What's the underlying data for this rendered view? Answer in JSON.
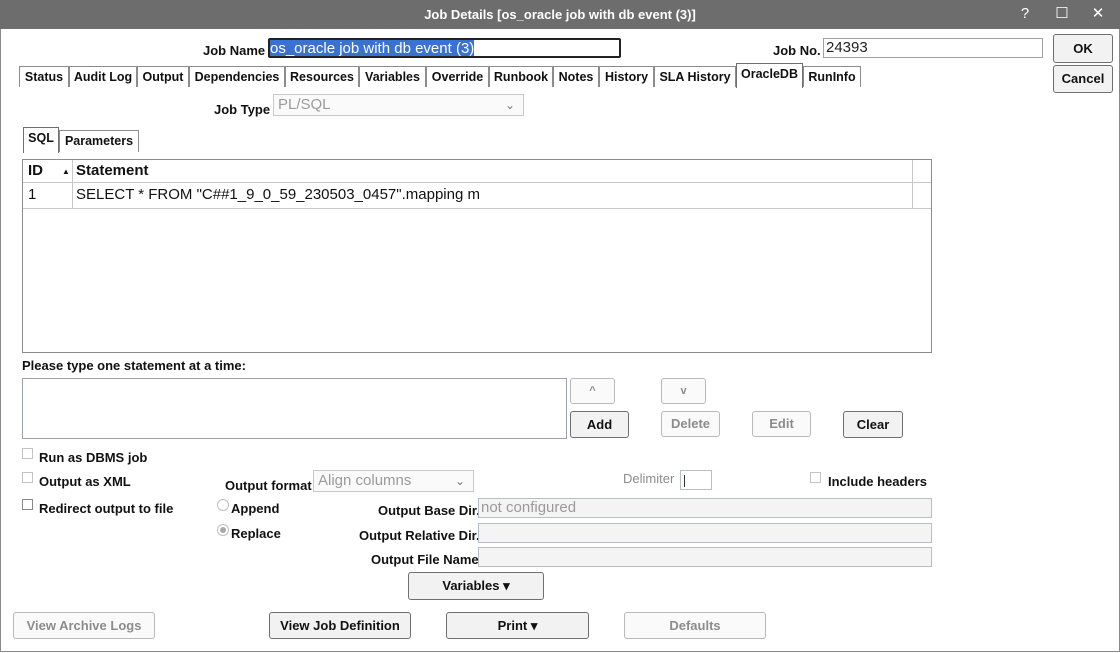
{
  "window": {
    "title": "Job Details [os_oracle job with db event (3)]",
    "help": "?",
    "maximize": "☐",
    "close": "✕"
  },
  "header": {
    "job_name_label": "Job Name",
    "job_name_value": "os_oracle job with db event (3)",
    "job_no_label": "Job No.",
    "job_no_value": "24393"
  },
  "actions": {
    "ok": "OK",
    "cancel": "Cancel"
  },
  "tabs": [
    {
      "label": "Status"
    },
    {
      "label": "Audit Log"
    },
    {
      "label": "Output"
    },
    {
      "label": "Dependencies"
    },
    {
      "label": "Resources"
    },
    {
      "label": "Variables"
    },
    {
      "label": "Override"
    },
    {
      "label": "Runbook"
    },
    {
      "label": "Notes"
    },
    {
      "label": "History"
    },
    {
      "label": "SLA History"
    },
    {
      "label": "OracleDB"
    },
    {
      "label": "RunInfo"
    }
  ],
  "oracle": {
    "job_type_label": "Job Type",
    "job_type_value": "PL/SQL",
    "subtabs": [
      {
        "label": "SQL"
      },
      {
        "label": "Parameters"
      }
    ],
    "table": {
      "columns": [
        "ID",
        "Statement"
      ],
      "rows": [
        {
          "id": "1",
          "statement": "SELECT * FROM \"C##1_9_0_59_230503_0457\".mapping m"
        }
      ]
    },
    "prompt": "Please type one statement at a time:",
    "btn_up": "^",
    "btn_down": "v",
    "btn_add": "Add",
    "btn_delete": "Delete",
    "btn_edit": "Edit",
    "btn_clear": "Clear",
    "run_dbms": "Run as DBMS job",
    "output_xml": "Output as XML",
    "redirect": "Redirect output to file",
    "output_format_label": "Output format",
    "output_format_value": "Align columns",
    "delimiter_label": "Delimiter",
    "include_headers": "Include headers",
    "append": "Append",
    "replace": "Replace",
    "base_dir_label": "Output Base Dir.",
    "base_dir_value": "not configured",
    "rel_dir_label": "Output Relative Dir.",
    "file_name_label": "Output File Name",
    "variables_btn": "Variables ▾"
  },
  "footer": {
    "archive": "View Archive Logs",
    "definition": "View Job Definition",
    "print": "Print ▾",
    "defaults": "Defaults"
  }
}
